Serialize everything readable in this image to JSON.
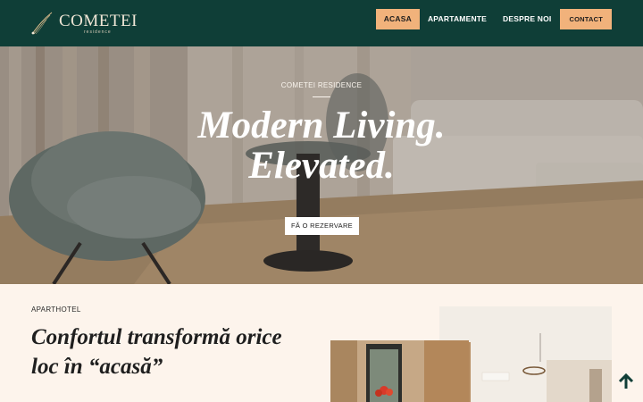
{
  "header": {
    "logo_text": "COMETEI",
    "logo_sub": "residence",
    "nav": [
      {
        "label": "ACASA",
        "active": true
      },
      {
        "label": "APARTAMENTE",
        "active": false
      },
      {
        "label": "DESPRE NOI",
        "active": false
      }
    ],
    "contact_label": "CONTACT"
  },
  "hero": {
    "kicker": "COMETEI RESIDENCE",
    "title_line1": "Modern Living.",
    "title_line2": "Elevated.",
    "cta_label": "FĂ O REZERVARE"
  },
  "intro": {
    "label": "APARTHOTEL",
    "title_line1": "Confortul transformă orice",
    "title_line2": "loc în “acasă”"
  },
  "colors": {
    "header_bg": "#0f3e37",
    "accent": "#f1b27b",
    "page_bg": "#fdf4ec"
  },
  "icons": {
    "scroll_top": "arrow-up-icon"
  }
}
